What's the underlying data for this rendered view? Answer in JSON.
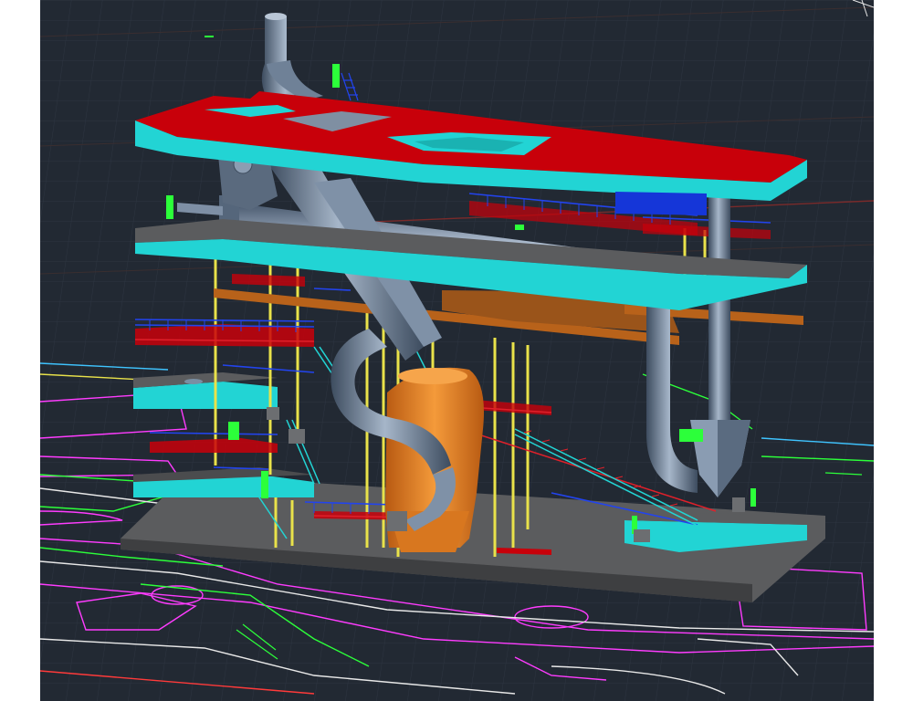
{
  "viewport": {
    "background": "#222933",
    "grid_color": "#2e3642"
  },
  "colors": {
    "deck_top": "#c8000a",
    "deck_edge": "#22d4d4",
    "duct": "#8a9cb2",
    "duct_dark": "#4e5f74",
    "column": "#e9e24a",
    "beam": "#b8621a",
    "vessel": "#ee8a2a",
    "rail_red": "#e0202a",
    "rail_blue": "#2244ee",
    "slab": "#5b5c5e",
    "ground_magenta": "#ff3cff",
    "ground_green": "#2cff3a",
    "ground_white": "#e8e8e8"
  }
}
